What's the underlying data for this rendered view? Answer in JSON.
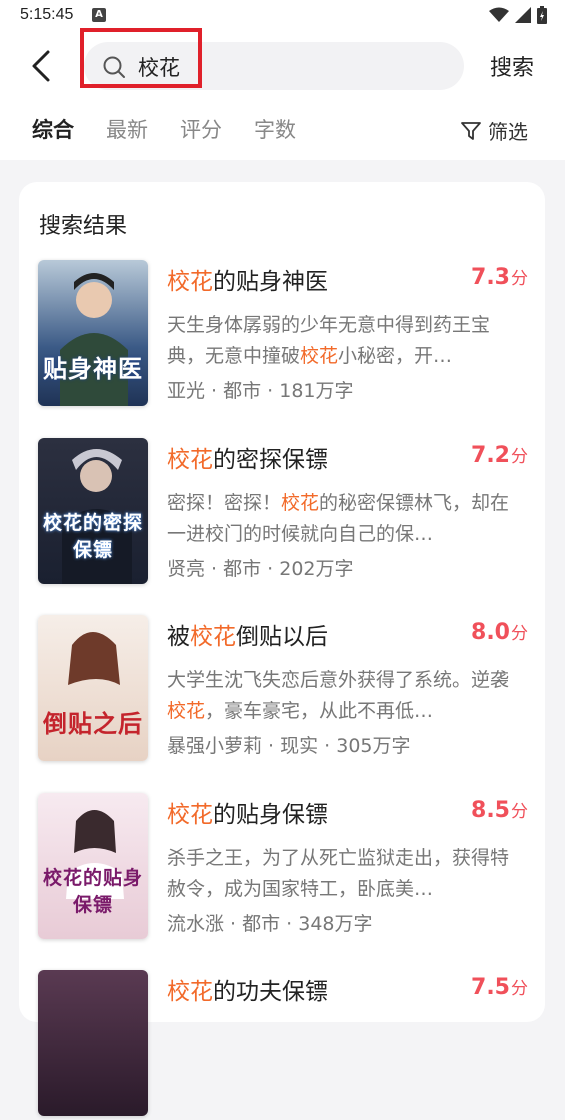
{
  "status_bar": {
    "time": "5:15:45",
    "notif": "A"
  },
  "search": {
    "query": "校花",
    "button_label": "搜索"
  },
  "tabs": [
    {
      "label": "综合",
      "active": true
    },
    {
      "label": "最新",
      "active": false
    },
    {
      "label": "评分",
      "active": false
    },
    {
      "label": "字数",
      "active": false
    }
  ],
  "filter_label": "筛选",
  "section_title": "搜索结果",
  "books": [
    {
      "title_pre": "",
      "title_hl": "校花",
      "title_post": "的贴身神医",
      "score": "7.3",
      "score_unit": "分",
      "desc_pre": "天生身体孱弱的少年无意中得到药王宝典，无意中撞破",
      "desc_hl": "校花",
      "desc_post": "小秘密，开…",
      "meta": "亚光 · 都市 · 181万字",
      "cover_text": "贴身神医",
      "cover_color": "#2e4a74"
    },
    {
      "title_pre": "",
      "title_hl": "校花",
      "title_post": "的密探保镖",
      "score": "7.2",
      "score_unit": "分",
      "desc_pre": "密探！密探！",
      "desc_hl": "校花",
      "desc_post": "的秘密保镖林飞，却在一进校门的时候就向自己的保…",
      "meta": "贤亮 · 都市 · 202万字",
      "cover_text": "校花的密探保镖",
      "cover_color": "#1d2638"
    },
    {
      "title_pre": "被",
      "title_hl": "校花",
      "title_post": "倒贴以后",
      "score": "8.0",
      "score_unit": "分",
      "desc_pre": "大学生沈飞失恋后意外获得了系统。逆袭",
      "desc_hl": "校花",
      "desc_post": "，豪车豪宅，从此不再低…",
      "meta": "暴强小萝莉 · 现实 · 305万字",
      "cover_text": "倒贴之后",
      "cover_color": "#efe1d6"
    },
    {
      "title_pre": "",
      "title_hl": "校花",
      "title_post": "的贴身保镖",
      "score": "8.5",
      "score_unit": "分",
      "desc_pre": "杀手之王，为了从死亡监狱走出，获得特赦令，成为国家特工，卧底美…",
      "desc_hl": "",
      "desc_post": "",
      "meta": "流水涨 · 都市 · 348万字",
      "cover_text": "校花的贴身保镖",
      "cover_color": "#f1dde4"
    },
    {
      "title_pre": "",
      "title_hl": "校花",
      "title_post": "的功夫保镖",
      "score": "7.5",
      "score_unit": "分",
      "desc_pre": "",
      "desc_hl": "",
      "desc_post": "",
      "meta": "",
      "cover_text": "",
      "cover_color": "#3a2a3a"
    }
  ]
}
